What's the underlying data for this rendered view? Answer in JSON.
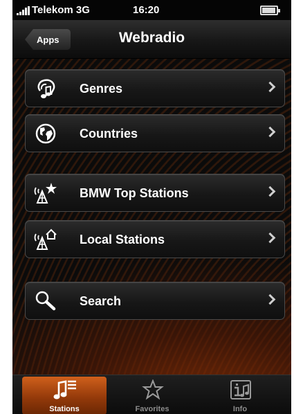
{
  "status_bar": {
    "carrier": "Telekom",
    "network": "3G",
    "time": "16:20"
  },
  "nav": {
    "back_label": "Apps",
    "title": "Webradio"
  },
  "menu": {
    "items": [
      {
        "label": "Genres",
        "icon": "music-note-head-icon"
      },
      {
        "label": "Countries",
        "icon": "globe-icon"
      },
      {
        "label": "BMW Top Stations",
        "icon": "antenna-star-icon"
      },
      {
        "label": "Local Stations",
        "icon": "antenna-home-icon"
      },
      {
        "label": "Search",
        "icon": "magnifier-icon"
      }
    ]
  },
  "tab_bar": {
    "tabs": [
      {
        "label": "Stations",
        "icon": "stations-icon",
        "active": true
      },
      {
        "label": "Favorites",
        "icon": "star-icon",
        "active": false
      },
      {
        "label": "Info",
        "icon": "info-music-icon",
        "active": false
      }
    ]
  },
  "colors": {
    "accent": "#c2561a",
    "background": "#0b0b0b",
    "text": "#ffffff"
  }
}
